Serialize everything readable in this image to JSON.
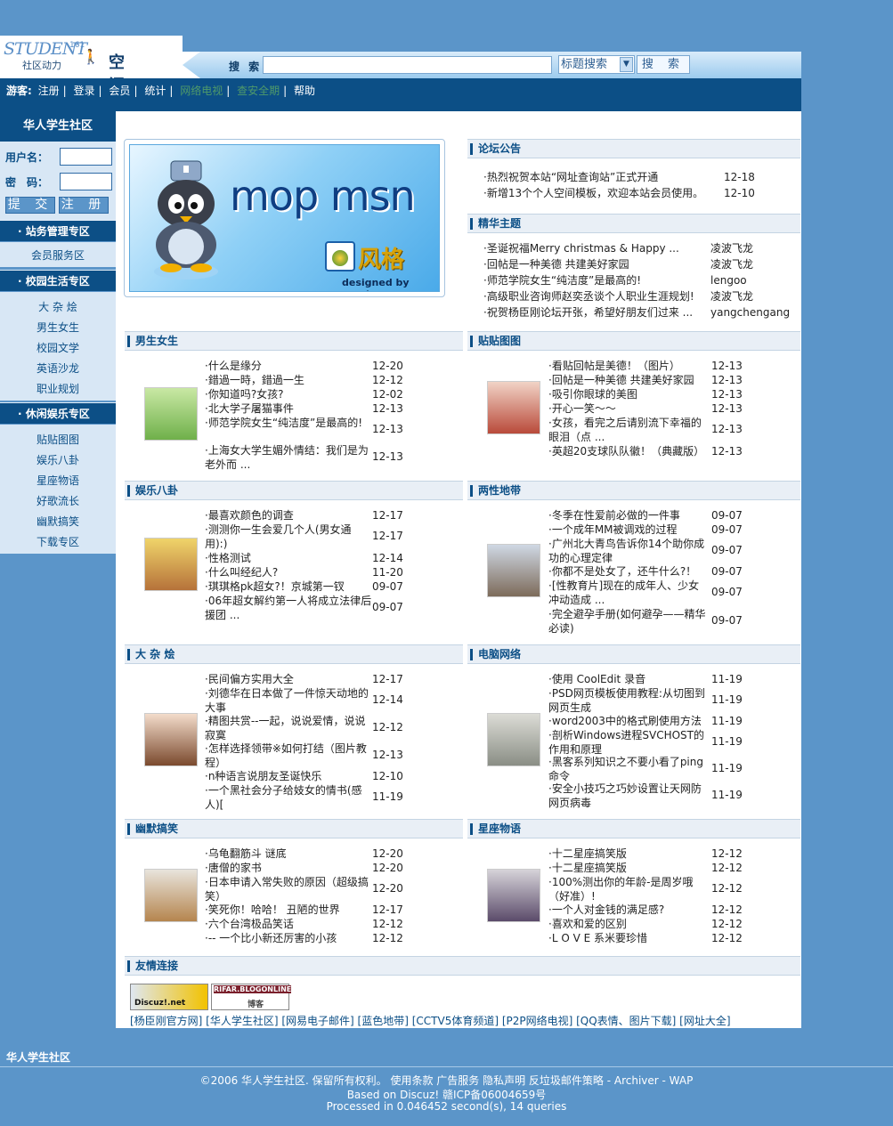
{
  "header": {
    "logo_main": "STUDENT",
    "logo_number": "161",
    "logo_sub": "社区动力",
    "logo_title": "空 间",
    "search_label": "搜 索",
    "search_value": "",
    "search_type": "标题搜索",
    "search_button": "搜 索"
  },
  "nav": {
    "guest": "游客:",
    "items": [
      "注册",
      "登录",
      "会员",
      "统计",
      "网络电视",
      "查安全期",
      "帮助"
    ]
  },
  "sidebar": {
    "title": "华人学生社区",
    "username_label": "用户名：",
    "password_label": "密　码：",
    "submit": "提 交",
    "register": "注 册",
    "zones": [
      {
        "title": "· 站务管理专区",
        "links": [
          "会员服务区"
        ]
      },
      {
        "title": "· 校园生活专区",
        "links": [
          "大 杂 烩",
          "男生女生",
          "校园文学",
          "英语沙龙",
          "职业规划"
        ]
      },
      {
        "title": "· 休闲娱乐专区",
        "links": [
          "贴贴图图",
          "娱乐八卦",
          "星座物语",
          "好歌流长",
          "幽默搞笑",
          "下载专区"
        ]
      }
    ]
  },
  "banner": {
    "text": "mop msn",
    "sub": "风格",
    "credit": "designed by mouter"
  },
  "sections": {
    "announce": {
      "title": "论坛公告",
      "rows": [
        {
          "t": "·热烈祝贺本站“网址查询站”正式开通",
          "d": "12-18"
        },
        {
          "t": "·新增13个个人空间模板，欢迎本站会员使用。",
          "d": "12-10"
        }
      ]
    },
    "featured": {
      "title": "精华主题",
      "rows": [
        {
          "t": "·圣诞祝福Merry christmas & Happy ...",
          "d": "凌波飞龙"
        },
        {
          "t": "·回帖是一种美德 共建美好家园",
          "d": "凌波飞龙"
        },
        {
          "t": "·师范学院女生“纯洁度”是最高的!",
          "d": "lengoo"
        },
        {
          "t": "·高级职业咨询师赵奕丞谈个人职业生涯规划!",
          "d": "凌波飞龙"
        },
        {
          "t": "·祝贺杨臣刚论坛开张，希望好朋友们过来 ...",
          "d": "yangchengang"
        }
      ]
    },
    "boys_girls": {
      "title": "男生女生",
      "rows": [
        {
          "t": "·什么是缘分",
          "d": "12-20"
        },
        {
          "t": "·錯過一時，錯過一生",
          "d": "12-12"
        },
        {
          "t": "·你知道吗?女孩?",
          "d": "12-02"
        },
        {
          "t": "·北大学子屠猫事件",
          "d": "12-13"
        },
        {
          "t": "·师范学院女生“纯洁度”是最高的!",
          "d": "12-13"
        },
        {
          "t": "·上海女大学生媚外情结：我们是为老外而 ...",
          "d": "12-13"
        }
      ]
    },
    "pictures": {
      "title": "贴贴图图",
      "rows": [
        {
          "t": "·看贴回帖是美德！（图片）",
          "d": "12-13"
        },
        {
          "t": "·回帖是一种美德 共建美好家园",
          "d": "12-13"
        },
        {
          "t": "·吸引你眼球的美图",
          "d": "12-13"
        },
        {
          "t": "·开心一笑～～",
          "d": "12-13"
        },
        {
          "t": "·女孩，看完之后请别流下幸福的眼泪（点 ...",
          "d": "12-13"
        },
        {
          "t": "·英超20支球队队徽！（典藏版）",
          "d": "12-13"
        }
      ]
    },
    "gossip": {
      "title": "娱乐八卦",
      "rows": [
        {
          "t": "·最喜欢颜色的调查",
          "d": "12-17"
        },
        {
          "t": "·测测你一生会爱几个人(男女通用):)",
          "d": "12-17"
        },
        {
          "t": "·性格测试",
          "d": "12-14"
        },
        {
          "t": "·什么叫经纪人?",
          "d": "11-20"
        },
        {
          "t": "·琪琪格pk超女?！京城第一钗",
          "d": "09-07"
        },
        {
          "t": "·06年超女解约第一人将成立法律后援团 ...",
          "d": "09-07"
        }
      ]
    },
    "gender": {
      "title": "两性地带",
      "rows": [
        {
          "t": "·冬季在性爱前必做的一件事",
          "d": "09-07"
        },
        {
          "t": "·一个成年MM被调戏的过程",
          "d": "09-07"
        },
        {
          "t": "·广州北大青鸟告诉你14个助你成功的心理定律",
          "d": "09-07"
        },
        {
          "t": "·你都不是处女了，还牛什么?！",
          "d": "09-07"
        },
        {
          "t": "·[性教育片]现在的成年人、少女冲动造成 ...",
          "d": "09-07"
        },
        {
          "t": "·完全避孕手册(如何避孕——精华必读)",
          "d": "09-07"
        }
      ]
    },
    "misc": {
      "title": "大 杂 烩",
      "rows": [
        {
          "t": "·民间偏方实用大全",
          "d": "12-17"
        },
        {
          "t": "·刘德华在日本做了一件惊天动地的大事",
          "d": "12-14"
        },
        {
          "t": "·精图共赏--一起，说说爱情，说说寂寞",
          "d": "12-12"
        },
        {
          "t": "·怎样选择领带※如何打结（图片教程）",
          "d": "12-13"
        },
        {
          "t": "·n种语言说朋友圣诞快乐",
          "d": "12-10"
        },
        {
          "t": "·一个黑社会分子给妓女的情书(感人)[",
          "d": "11-19"
        }
      ]
    },
    "computer": {
      "title": "电脑网络",
      "rows": [
        {
          "t": "·使用 CoolEdit 录音",
          "d": "11-19"
        },
        {
          "t": "·PSD网页模板使用教程:从切图到网页生成",
          "d": "11-19"
        },
        {
          "t": "·word2003中的格式刷使用方法",
          "d": "11-19"
        },
        {
          "t": "·剖析Windows进程SVCHOST的作用和原理",
          "d": "11-19"
        },
        {
          "t": "·黑客系列知识之不要小看了ping命令",
          "d": "11-19"
        },
        {
          "t": "·安全小技巧之巧妙设置让天网防网页病毒",
          "d": "11-19"
        }
      ]
    },
    "humor": {
      "title": "幽默搞笑",
      "rows": [
        {
          "t": "·乌龟翻筋斗 谜底",
          "d": "12-20"
        },
        {
          "t": "·唐僧的家书",
          "d": "12-20"
        },
        {
          "t": "·日本申请入常失败的原因（超级搞笑）",
          "d": "12-20"
        },
        {
          "t": "·笑死你！哈哈！ 丑陋的世界",
          "d": "12-17"
        },
        {
          "t": "·六个台湾极品笑话",
          "d": "12-12"
        },
        {
          "t": "·-- 一个比小新还厉害的小孩",
          "d": "12-12"
        }
      ]
    },
    "zodiac": {
      "title": "星座物语",
      "rows": [
        {
          "t": "·十二星座搞笑版",
          "d": "12-12"
        },
        {
          "t": "·十二星座搞笑版",
          "d": "12-12"
        },
        {
          "t": "·100%测出你的年龄-是周岁哦（好准）!",
          "d": "12-12"
        },
        {
          "t": "·一个人对金钱的满足感?",
          "d": "12-12"
        },
        {
          "t": "·喜欢和爱的区别",
          "d": "12-12"
        },
        {
          "t": "·L O V E 系米要珍惜",
          "d": "12-12"
        }
      ]
    },
    "friends": {
      "title": "友情连接",
      "logo1": "Discuz!.net",
      "logo2_top": "RIFAR.BLOGONLINE",
      "logo2_bottom": "博客",
      "links": "[杨臣刚官方网] [华人学生社区] [网易电子邮件] [蓝色地带] [CCTV5体育频道] [P2P网络电视] [QQ表情、图片下载] [网址大全]"
    }
  },
  "footer": {
    "title": "华人学生社区",
    "line1": "©2006 华人学生社区. 保留所有权利。  使用条款  广告服务  隐私声明  反垃圾邮件策略 - Archiver - WAP",
    "line2": "Based on Discuz!  赣ICP备06004659号",
    "line3": "Processed in 0.046452 second(s), 14 queries"
  },
  "colors": {
    "page_bg": "#5b95c9",
    "nav_bg": "#0c4f86",
    "sidebar_panel": "#d8e7f5"
  }
}
